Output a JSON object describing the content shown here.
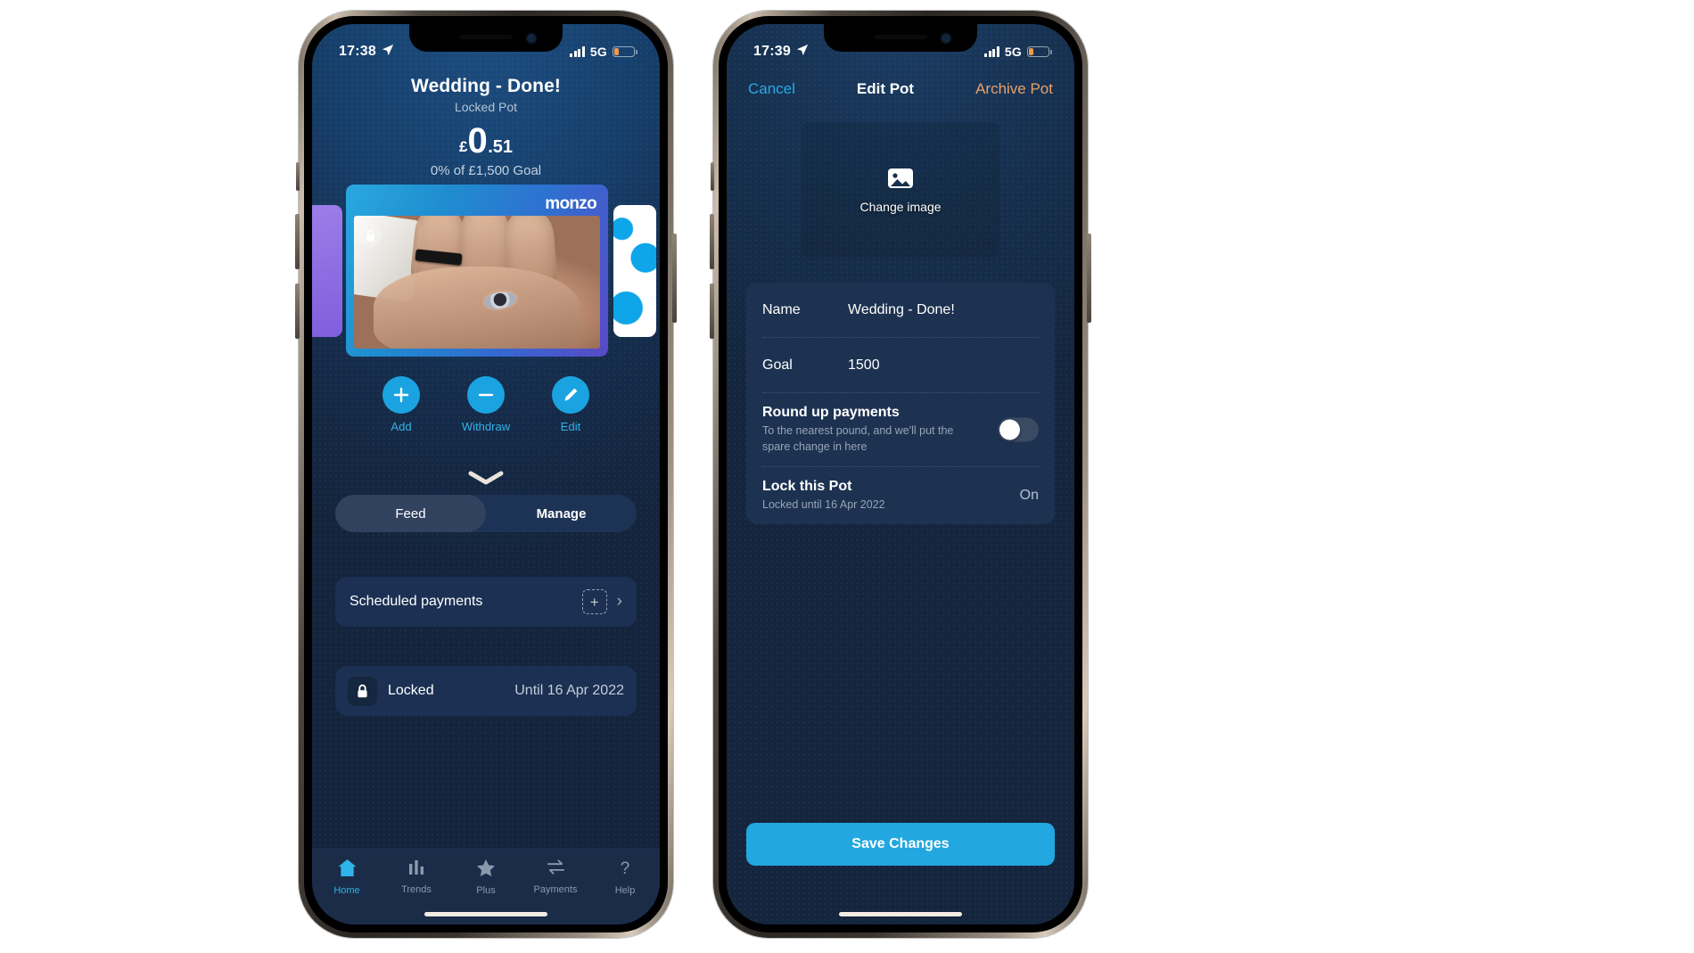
{
  "phone1": {
    "status_bar": {
      "time": "17:38",
      "location_icon": "location-arrow-icon",
      "signal_icon": "cellular-bars-icon",
      "network": "5G",
      "battery_icon": "battery-low-icon"
    },
    "pot": {
      "title": "Wedding - Done!",
      "subtitle": "Locked Pot",
      "currency_symbol": "£",
      "amount_major": "0",
      "amount_minor": ".51",
      "goal_text": "0% of £1,500 Goal",
      "card_brand": "monzo",
      "lock_icon": "lock-icon"
    },
    "actions": [
      {
        "label": "Add",
        "icon": "plus-icon"
      },
      {
        "label": "Withdraw",
        "icon": "minus-icon"
      },
      {
        "label": "Edit",
        "icon": "pencil-icon"
      }
    ],
    "collapse_icon": "chevron-down-icon",
    "segmented": {
      "feed": "Feed",
      "manage": "Manage"
    },
    "rows": {
      "scheduled": {
        "label": "Scheduled payments",
        "add_icon": "add-dashed-icon",
        "chevron": "chevron-right-icon"
      },
      "locked": {
        "icon": "lock-icon",
        "label": "Locked",
        "value": "Until 16 Apr 2022"
      }
    },
    "tabs": [
      {
        "label": "Home",
        "icon": "home-icon"
      },
      {
        "label": "Trends",
        "icon": "bar-chart-icon"
      },
      {
        "label": "Plus",
        "icon": "star-icon"
      },
      {
        "label": "Payments",
        "icon": "transfer-arrows-icon"
      },
      {
        "label": "Help",
        "icon": "question-mark-icon"
      }
    ],
    "accent": "#2fb3ea"
  },
  "phone2": {
    "status_bar": {
      "time": "17:39",
      "location_icon": "location-arrow-icon",
      "signal_icon": "cellular-bars-icon",
      "network": "5G",
      "battery_icon": "battery-low-icon"
    },
    "nav": {
      "cancel": "Cancel",
      "title": "Edit Pot",
      "archive": "Archive Pot"
    },
    "image": {
      "change_label": "Change image",
      "icon": "photo-icon"
    },
    "form": {
      "name": {
        "label": "Name",
        "value": "Wedding - Done!"
      },
      "goal": {
        "label": "Goal",
        "value": "1500"
      },
      "roundup": {
        "title": "Round up payments",
        "description": "To the nearest pound, and we'll put the spare change in here",
        "toggle_state": "off"
      },
      "lock": {
        "title": "Lock this Pot",
        "description": "Locked until 16 Apr 2022",
        "value": "On"
      }
    },
    "save_label": "Save Changes",
    "accent": "#22a7e0",
    "archive_color": "#e8a06b"
  }
}
